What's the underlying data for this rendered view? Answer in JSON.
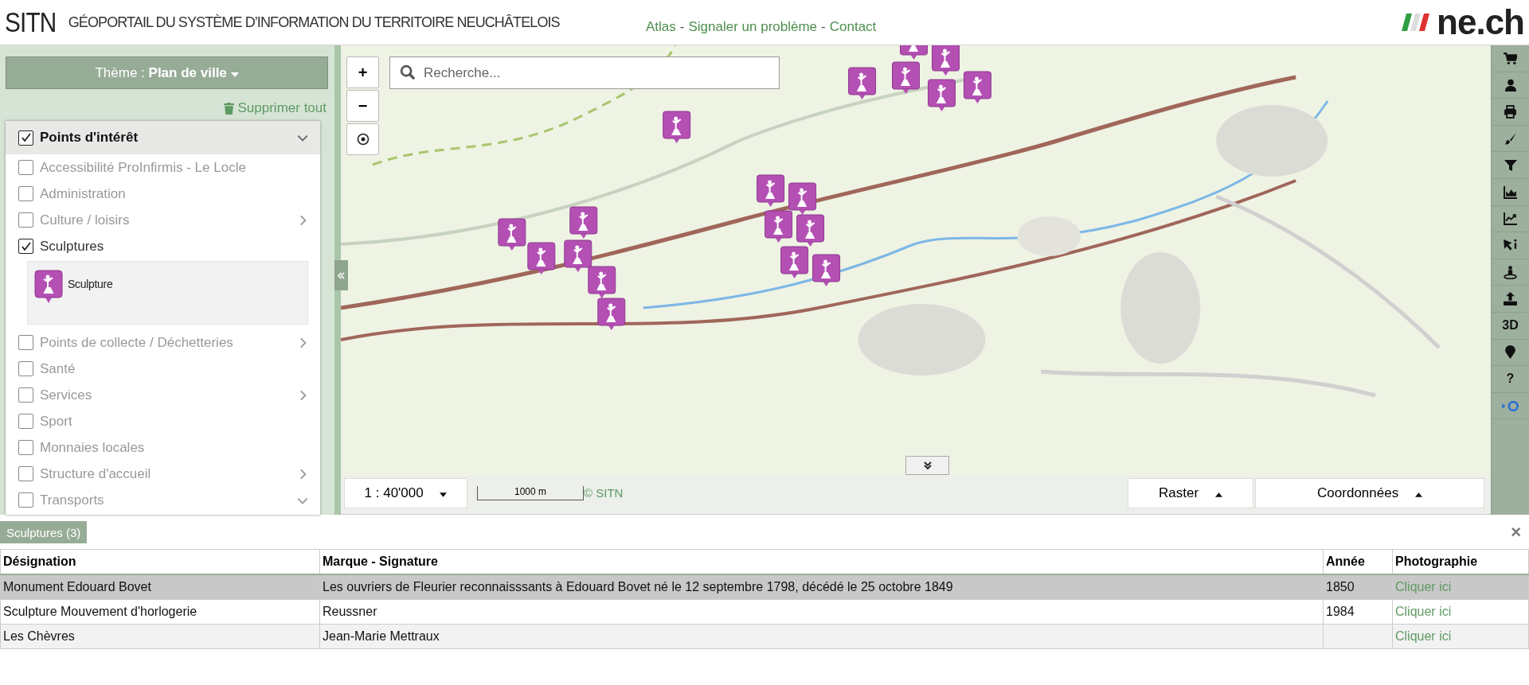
{
  "header": {
    "brand": "SITN",
    "title": "GÉOPORTAIL DU SYSTÈME D’INFORMATION DU TERRITOIRE NEUCHÂTELOIS",
    "links": [
      "Atlas",
      "Signaler un problème",
      "Contact"
    ],
    "separator": "-",
    "logo_text": "ne.ch"
  },
  "sidebar": {
    "theme_button": "Thème : **Plan de ville**",
    "clear_all": "Supprimer tout",
    "group": {
      "label": "Points d'intérêt",
      "checked": true,
      "expanded": true,
      "children": [
        {
          "label": "Accessibilité ProInfirmis - Le Locle",
          "checked": false
        },
        {
          "label": "Administration",
          "checked": false
        },
        {
          "label": "Culture / loisirs",
          "checked": false,
          "expanded": false
        },
        {
          "label": "Sculptures",
          "checked": true,
          "legend": "Sculpture"
        },
        {
          "label": "Points de collecte / Déchetteries",
          "checked": false,
          "expanded": false
        },
        {
          "label": "Santé",
          "checked": false
        },
        {
          "label": "Services",
          "checked": false,
          "expanded": false
        },
        {
          "label": "Sport",
          "checked": false
        },
        {
          "label": "Monnaies locales",
          "checked": false
        },
        {
          "label": "Structure d'accueil",
          "checked": false,
          "expanded": false
        },
        {
          "label": "Transports",
          "checked": false,
          "expanded": true
        }
      ]
    }
  },
  "map": {
    "zoom_in": "+",
    "zoom_out": "−",
    "search": {
      "placeholder": "Recherche..."
    },
    "scale": "1 : 40'000",
    "scale_bar": "1000 m",
    "copyright": "© SITN",
    "basemap": "Raster",
    "coordinates": "Coordonnées"
  },
  "toolbar": [
    {
      "kind": "cart"
    },
    {
      "kind": "user"
    },
    {
      "kind": "print"
    },
    {
      "kind": "brush"
    },
    {
      "kind": "filter"
    },
    {
      "kind": "area"
    },
    {
      "kind": "line"
    },
    {
      "kind": "info"
    },
    {
      "kind": "person"
    },
    {
      "kind": "upload"
    },
    {
      "kind": "text",
      "label": "3D"
    },
    {
      "kind": "marker"
    },
    {
      "kind": "text",
      "label": "?"
    },
    {
      "kind": "dot"
    }
  ],
  "results": {
    "tab": "Sculptures (3)",
    "close": "×",
    "columns": [
      "Désignation",
      "Marque - Signature",
      "Année",
      "Photographie"
    ],
    "rows": [
      {
        "cells": [
          "Monument Edouard Bovet",
          "Les ouvriers de Fleurier reconnaisssants à Edouard Bovet né le 12 septembre 1798, décédé le 25 octobre 1849",
          "1850",
          "Cliquer ici"
        ],
        "selected": true
      },
      {
        "cells": [
          "Sculpture Mouvement d'horlogerie",
          "Reussner",
          "1984",
          "Cliquer ici"
        ],
        "selected": false
      },
      {
        "cells": [
          "Les Chèvres",
          "Jean-Marie Mettraux",
          "",
          "Cliquer ici"
        ],
        "selected": false
      }
    ]
  }
}
